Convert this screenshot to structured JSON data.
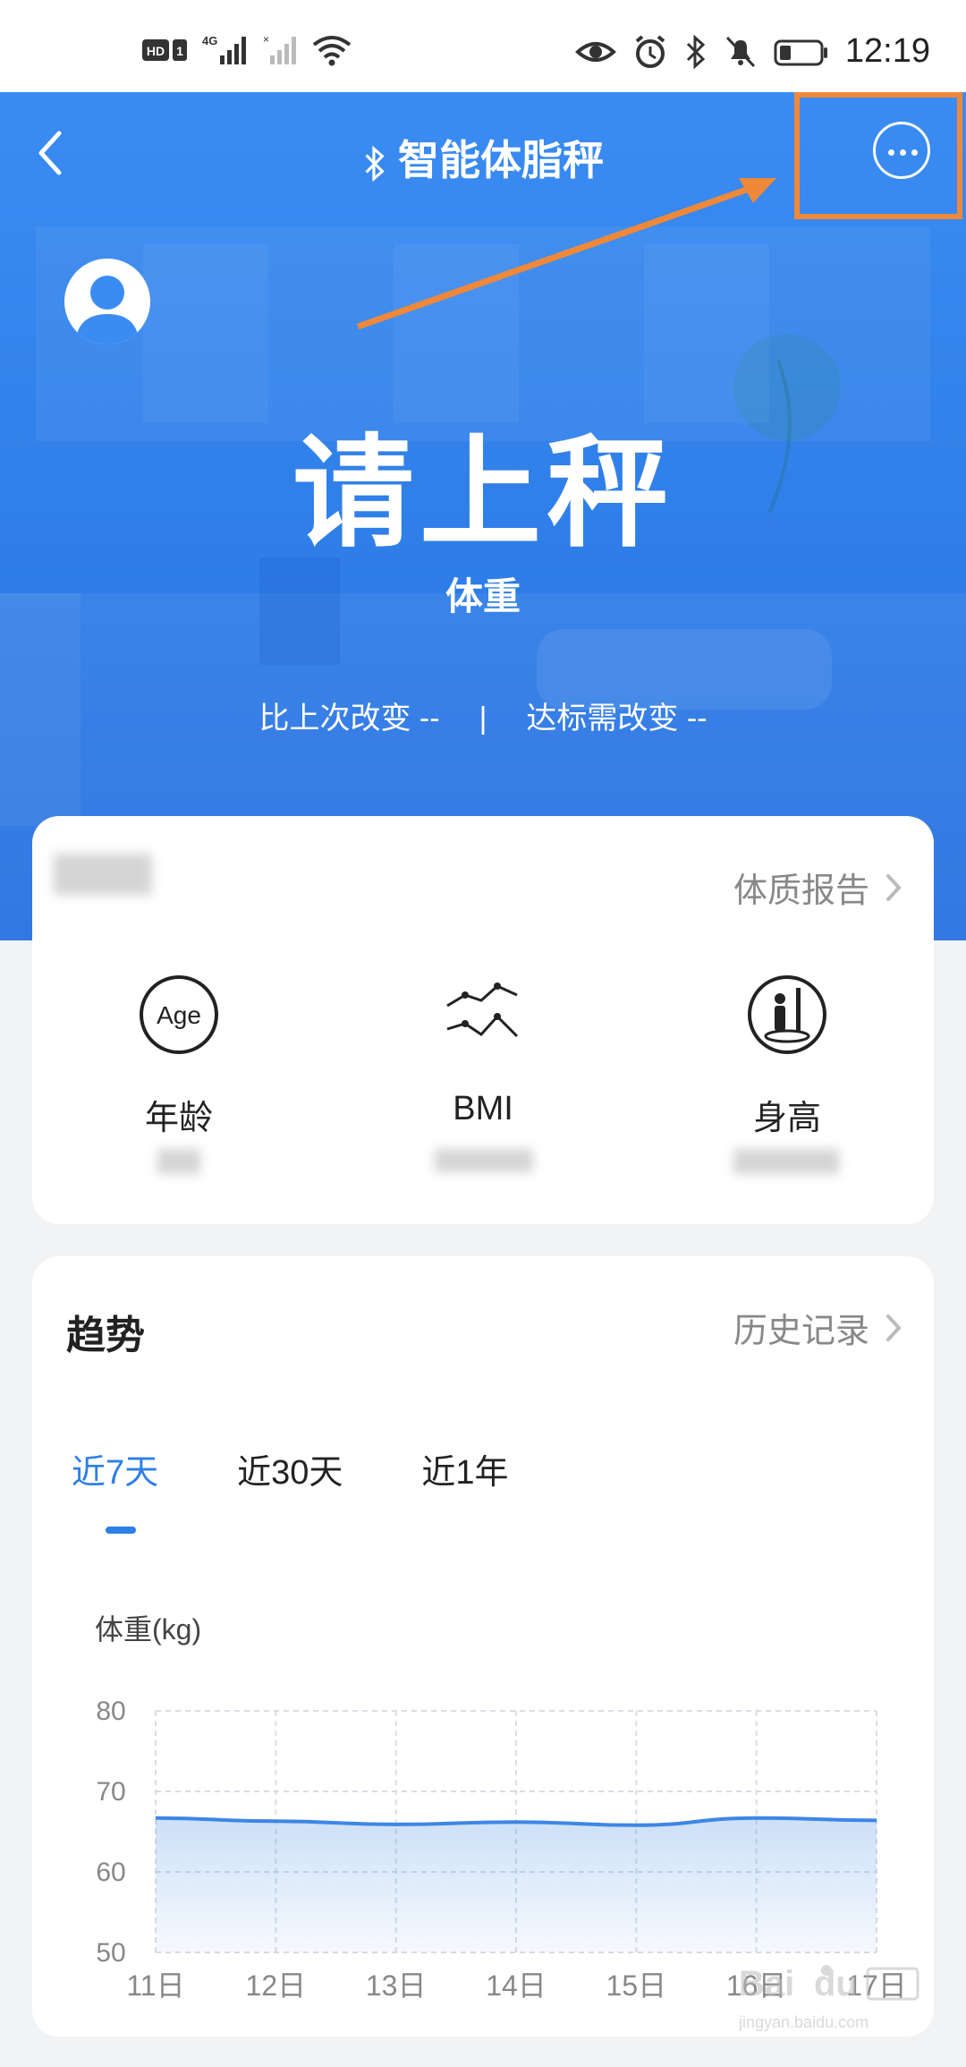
{
  "status_bar": {
    "time": "12:19",
    "left_icons": [
      "hd-icon",
      "4g-signal-icon",
      "signal-icon",
      "wifi-icon"
    ],
    "right_icons": [
      "eye-icon",
      "alarm-icon",
      "bluetooth-icon",
      "mute-icon",
      "battery-icon"
    ]
  },
  "header": {
    "title": "智能体脂秤",
    "back_icon": "chevron-left-icon",
    "more_icon": "more-horizontal-icon",
    "bluetooth_icon": "bluetooth-icon"
  },
  "hero": {
    "status_text": "请上秤",
    "weight_label": "体重",
    "change_since_last": "比上次改变 --",
    "separator": "|",
    "change_to_target": "达标需改变 --"
  },
  "profile_card": {
    "report_link": "体质报告",
    "metrics": [
      {
        "icon": "age-icon",
        "label": "年龄"
      },
      {
        "icon": "bmi-trend-icon",
        "label": "BMI"
      },
      {
        "icon": "height-icon",
        "label": "身高"
      }
    ]
  },
  "trend_card": {
    "title": "趋势",
    "history_link": "历史记录",
    "tabs": [
      "近7天",
      "近30天",
      "近1年"
    ],
    "active_tab": 0
  },
  "colors": {
    "accent": "#2e7fe6",
    "hero_blue": "#3a8cf2",
    "highlight_orange": "#f0883a"
  },
  "chart_data": {
    "type": "area",
    "ylabel": "体重(kg)",
    "ylim": [
      50,
      80
    ],
    "yticks": [
      80,
      70,
      60,
      50
    ],
    "categories": [
      "11日",
      "12日",
      "13日",
      "14日",
      "15日",
      "16日",
      "17日"
    ],
    "series": [
      {
        "values": [
          66.7,
          66.3,
          65.9,
          66.2,
          65.8,
          66.7,
          66.4
        ]
      }
    ],
    "grid": true
  }
}
